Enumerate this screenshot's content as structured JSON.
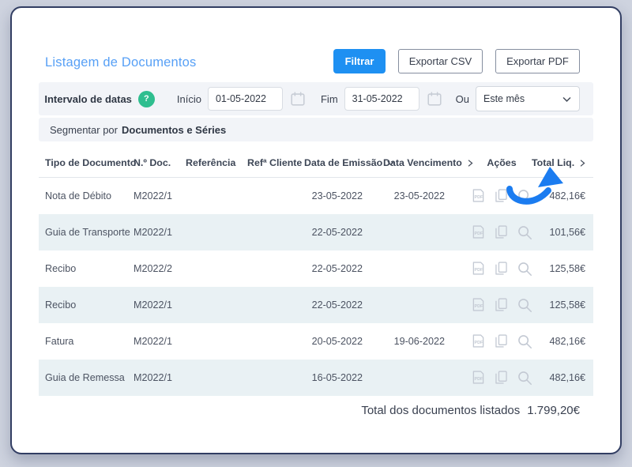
{
  "colors": {
    "page-bg": "#ced3df",
    "card-border": "#323e63",
    "title-blue": "#57a0f6",
    "accent-blue": "#1e90f2",
    "bar-bg": "#f2f4f8",
    "row-alt-bg": "#e9f1f4",
    "header-text": "#3d4656",
    "green-badge": "#2fbe8f",
    "arrow-blue": "#1b7cf0"
  },
  "page": {
    "title": "Listagem de Documentos"
  },
  "toolbar": {
    "filter_label": "Filtrar",
    "export_csv_label": "Exportar CSV",
    "export_pdf_label": "Exportar PDF"
  },
  "filters": {
    "date_range_label": "Intervalo de datas",
    "help_badge": "?",
    "start_label": "Início",
    "start_value": "01-05-2022",
    "end_label": "Fim",
    "end_value": "31-05-2022",
    "or_label": "Ou",
    "preset_selected": "Este mês",
    "segment_prefix": "Segmentar por",
    "segment_value": "Documentos e Séries"
  },
  "table": {
    "headers": [
      {
        "label": "Tipo de Documento",
        "sort": "none"
      },
      {
        "label": "N.º Doc.",
        "sort": "none"
      },
      {
        "label": "Referência",
        "sort": "none"
      },
      {
        "label": "Refª Cliente",
        "sort": "none"
      },
      {
        "label": "Data de Emissão",
        "sort": "down"
      },
      {
        "label": "Data Vencimento",
        "sort": "right"
      },
      {
        "label": "Ações",
        "sort": "none"
      },
      {
        "label": "Total Liq.",
        "sort": "right"
      }
    ],
    "actions": [
      "pdf",
      "copy",
      "view"
    ],
    "rows": [
      {
        "tipo": "Nota de Débito",
        "numero": "M2022/1",
        "referencia": "",
        "ref_cliente": "",
        "data_emissao": "23-05-2022",
        "data_vencimento": "23-05-2022",
        "total": "482,16€"
      },
      {
        "tipo": "Guia de Transporte",
        "numero": "M2022/1",
        "referencia": "",
        "ref_cliente": "",
        "data_emissao": "22-05-2022",
        "data_vencimento": "",
        "total": "101,56€"
      },
      {
        "tipo": "Recibo",
        "numero": "M2022/2",
        "referencia": "",
        "ref_cliente": "",
        "data_emissao": "22-05-2022",
        "data_vencimento": "",
        "total": "125,58€"
      },
      {
        "tipo": "Recibo",
        "numero": "M2022/1",
        "referencia": "",
        "ref_cliente": "",
        "data_emissao": "22-05-2022",
        "data_vencimento": "",
        "total": "125,58€"
      },
      {
        "tipo": "Fatura",
        "numero": "M2022/1",
        "referencia": "",
        "ref_cliente": "",
        "data_emissao": "20-05-2022",
        "data_vencimento": "19-06-2022",
        "total": "482,16€"
      },
      {
        "tipo": "Guia de Remessa",
        "numero": "M2022/1",
        "referencia": "",
        "ref_cliente": "",
        "data_emissao": "16-05-2022",
        "data_vencimento": "",
        "total": "482,16€"
      }
    ],
    "footer": {
      "label": "Total dos documentos listados",
      "value": "1.799,20€"
    }
  }
}
